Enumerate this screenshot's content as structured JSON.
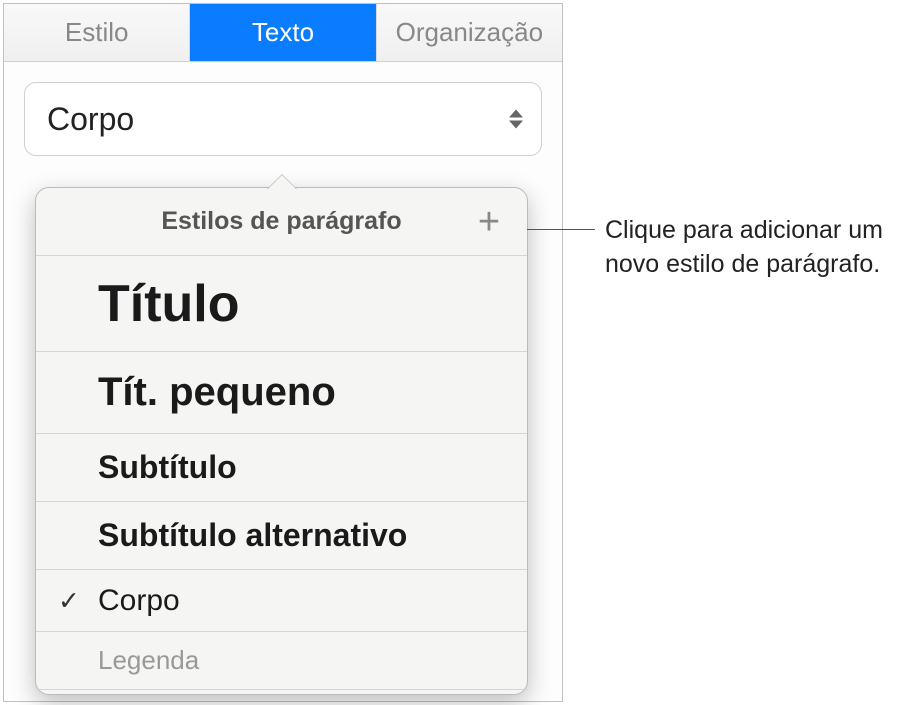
{
  "tabs": {
    "estilo": "Estilo",
    "texto": "Texto",
    "organizacao": "Organização"
  },
  "selector": {
    "current": "Corpo"
  },
  "popover": {
    "title": "Estilos de parágrafo",
    "items": [
      {
        "label": "Título",
        "class": "titulo",
        "selected": false
      },
      {
        "label": "Tít. pequeno",
        "class": "tit-pequeno",
        "selected": false
      },
      {
        "label": "Subtítulo",
        "class": "subtitulo",
        "selected": false
      },
      {
        "label": "Subtítulo alternativo",
        "class": "subtitulo-alt",
        "selected": false
      },
      {
        "label": "Corpo",
        "class": "corpo",
        "selected": true
      },
      {
        "label": "Legenda",
        "class": "legenda",
        "selected": false
      }
    ]
  },
  "callout": {
    "text": "Clique para adicionar um novo estilo de parágrafo."
  }
}
